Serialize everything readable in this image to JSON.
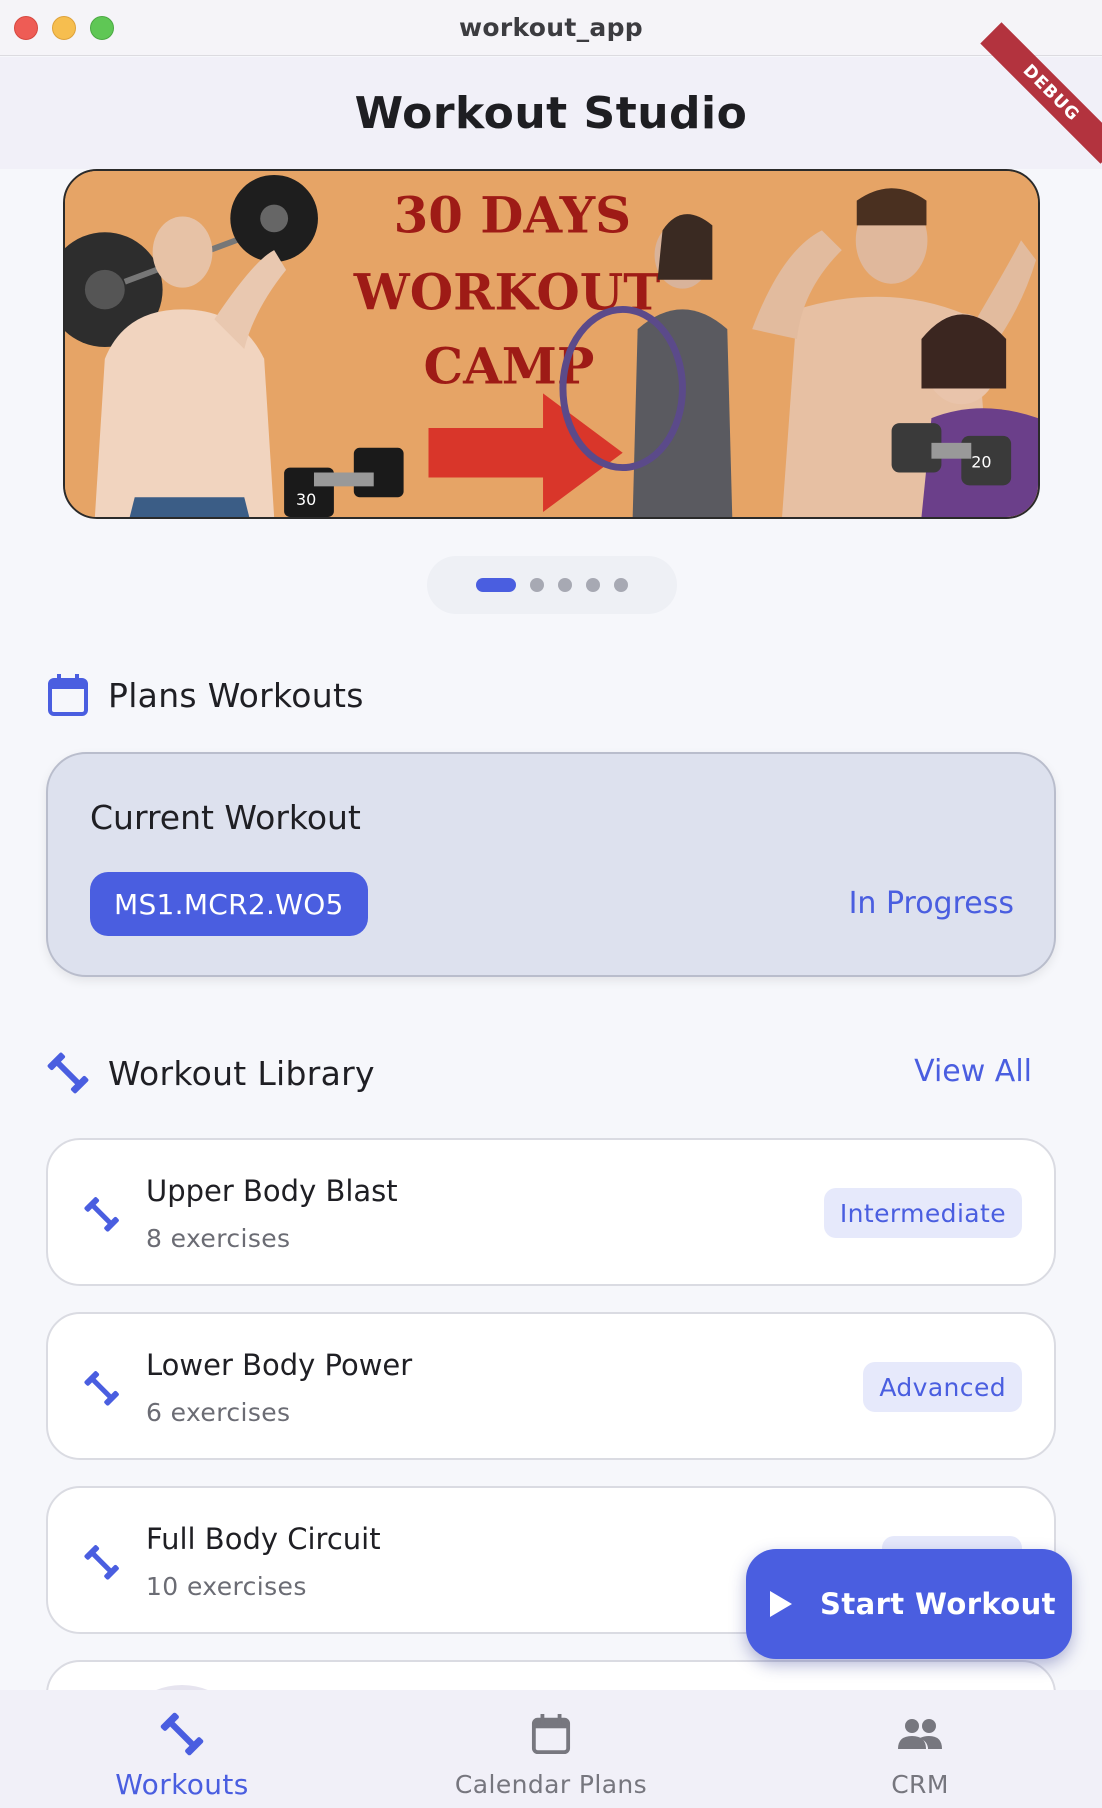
{
  "window": {
    "title": "workout_app"
  },
  "appbar": {
    "title": "Workout Studio",
    "debug_label": "DEBUG"
  },
  "banner": {
    "text_line1": "30 DAYS",
    "text_line2": "WORKOUT",
    "text_line3": "CAMP",
    "dumbbell_left_number": "30",
    "dumbbell_right_number": "20",
    "page_count": 5,
    "active_page": 1
  },
  "plans": {
    "title": "Plans Workouts",
    "card_label": "Current Workout",
    "current_code": "MS1.MCR2.WO5",
    "status": "In Progress"
  },
  "library": {
    "title": "Workout Library",
    "view_all": "View All",
    "items": [
      {
        "name": "Upper Body Blast",
        "count": "8 exercises",
        "level": "Intermediate"
      },
      {
        "name": "Lower Body Power",
        "count": "6 exercises",
        "level": "Advanced"
      },
      {
        "name": "Full Body Circuit",
        "count": "10 exercises",
        "level": ""
      }
    ]
  },
  "fab": {
    "label": "Start Workout"
  },
  "nav": {
    "items": [
      {
        "label": "Workouts",
        "icon": "dumbbell-icon",
        "active": true
      },
      {
        "label": "Calendar Plans",
        "icon": "calendar-icon",
        "active": false
      },
      {
        "label": "CRM",
        "icon": "people-icon",
        "active": false
      }
    ]
  },
  "colors": {
    "accent": "#4a5ee0",
    "banner_bg": "#e6a466",
    "banner_text": "#9e1b16",
    "debug": "#b3333e"
  }
}
